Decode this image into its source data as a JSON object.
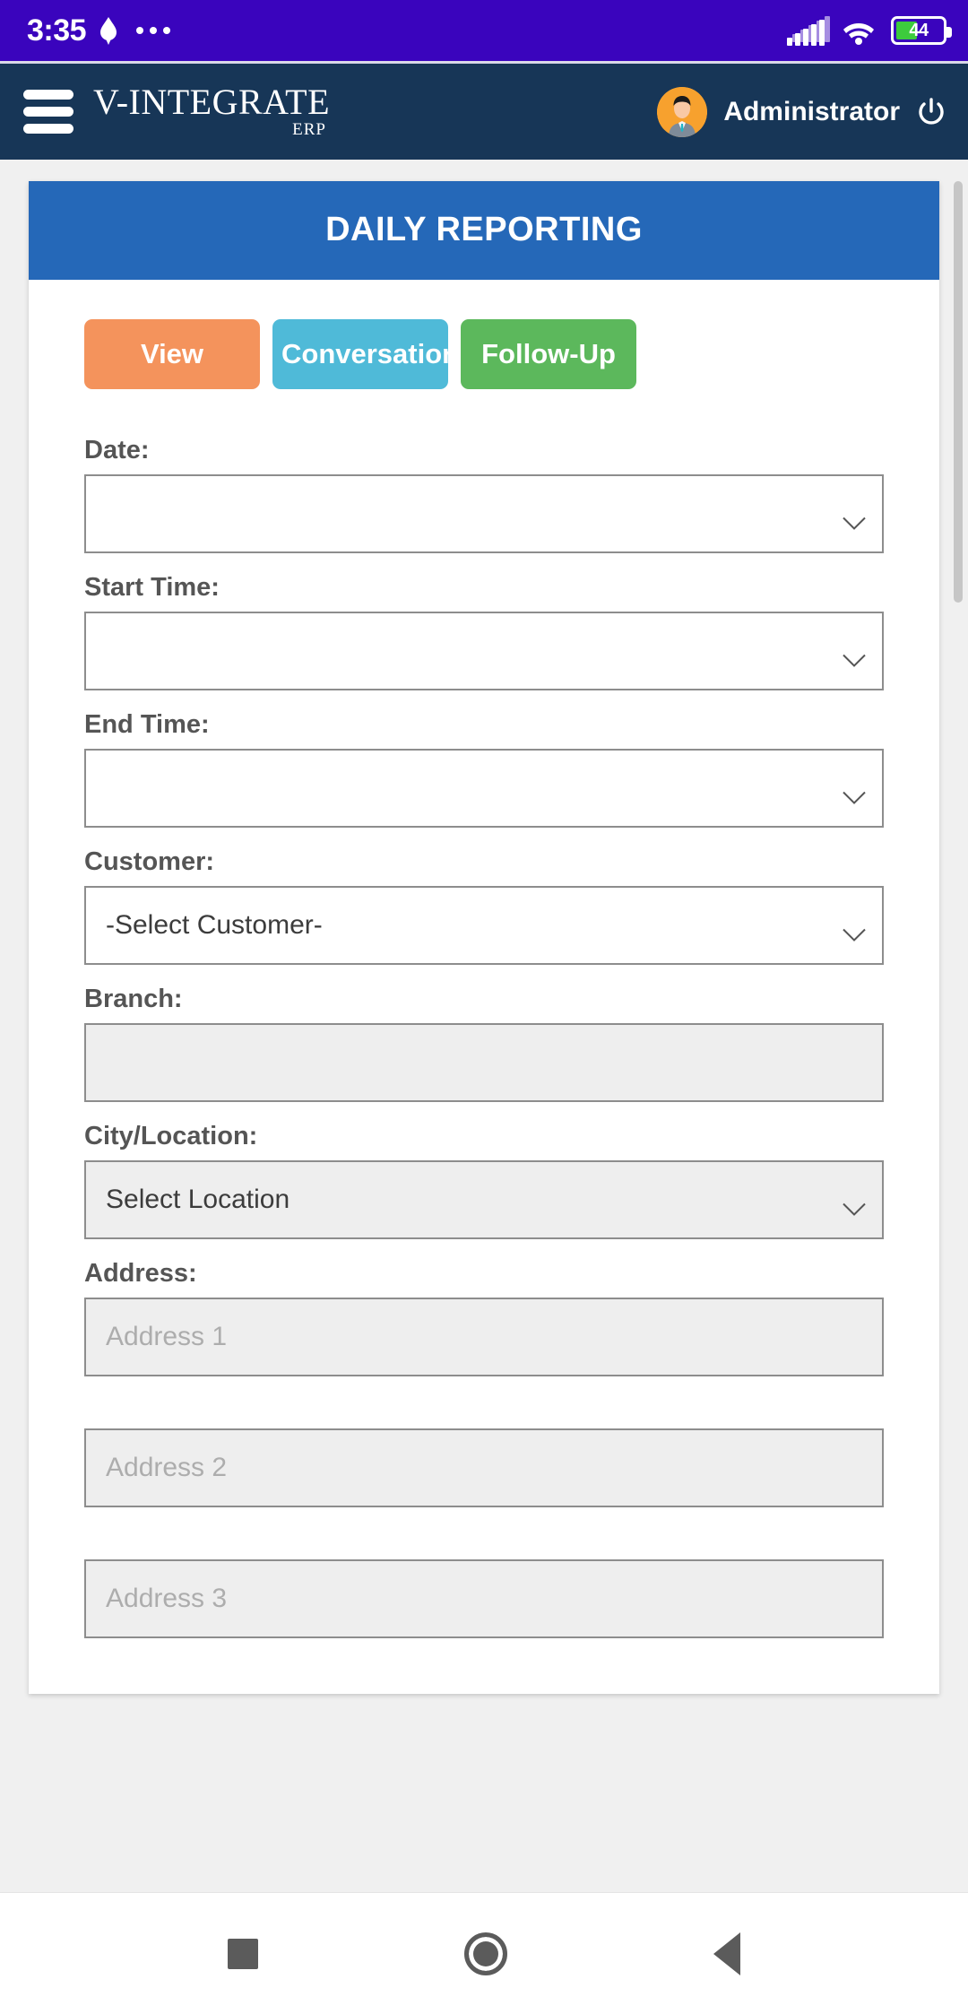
{
  "status_bar": {
    "time": "3:35",
    "battery_percent": "44",
    "icons": [
      "location-drop-icon",
      "more-dots-icon",
      "signal-bars-icon",
      "wifi-icon",
      "battery-icon"
    ],
    "background_color": "#3A04BD"
  },
  "app_header": {
    "menu_icon": "hamburger-menu-icon",
    "brand_main": "V-INTEGRATE",
    "brand_sub": "ERP",
    "user_name": "Administrator",
    "avatar_icon": "user-avatar-icon",
    "power_icon": "power-logout-icon",
    "background_color": "#173657"
  },
  "card": {
    "title": "DAILY REPORTING",
    "title_background": "#2568B8",
    "buttons": [
      {
        "label": "View",
        "color": "#F4935C",
        "name": "view-button"
      },
      {
        "label": "Conversation",
        "color": "#4FBAD8",
        "name": "conversation-button"
      },
      {
        "label": "Follow-Up",
        "color": "#5CB85C",
        "name": "followup-button"
      }
    ],
    "fields": [
      {
        "label": "Date:",
        "value": "",
        "placeholder": "",
        "type": "select",
        "disabled": false
      },
      {
        "label": "Start Time:",
        "value": "",
        "placeholder": "",
        "type": "select",
        "disabled": false
      },
      {
        "label": "End Time:",
        "value": "",
        "placeholder": "",
        "type": "select",
        "disabled": false
      },
      {
        "label": "Customer:",
        "value": "-Select Customer-",
        "placeholder": "",
        "type": "select",
        "disabled": false
      },
      {
        "label": "Branch:",
        "value": "",
        "placeholder": "",
        "type": "text",
        "disabled": true
      },
      {
        "label": "City/Location:",
        "value": "Select Location",
        "placeholder": "",
        "type": "select",
        "disabled": true
      },
      {
        "label": "Address:",
        "value": "",
        "placeholder": "Address 1",
        "type": "text",
        "disabled": true
      },
      {
        "label": "",
        "value": "",
        "placeholder": "Address 2",
        "type": "text",
        "disabled": true
      },
      {
        "label": "",
        "value": "",
        "placeholder": "Address 3",
        "type": "text",
        "disabled": true
      }
    ]
  },
  "nav_bar": {
    "recents_label": "recents-button",
    "home_label": "home-button",
    "back_label": "back-button"
  }
}
